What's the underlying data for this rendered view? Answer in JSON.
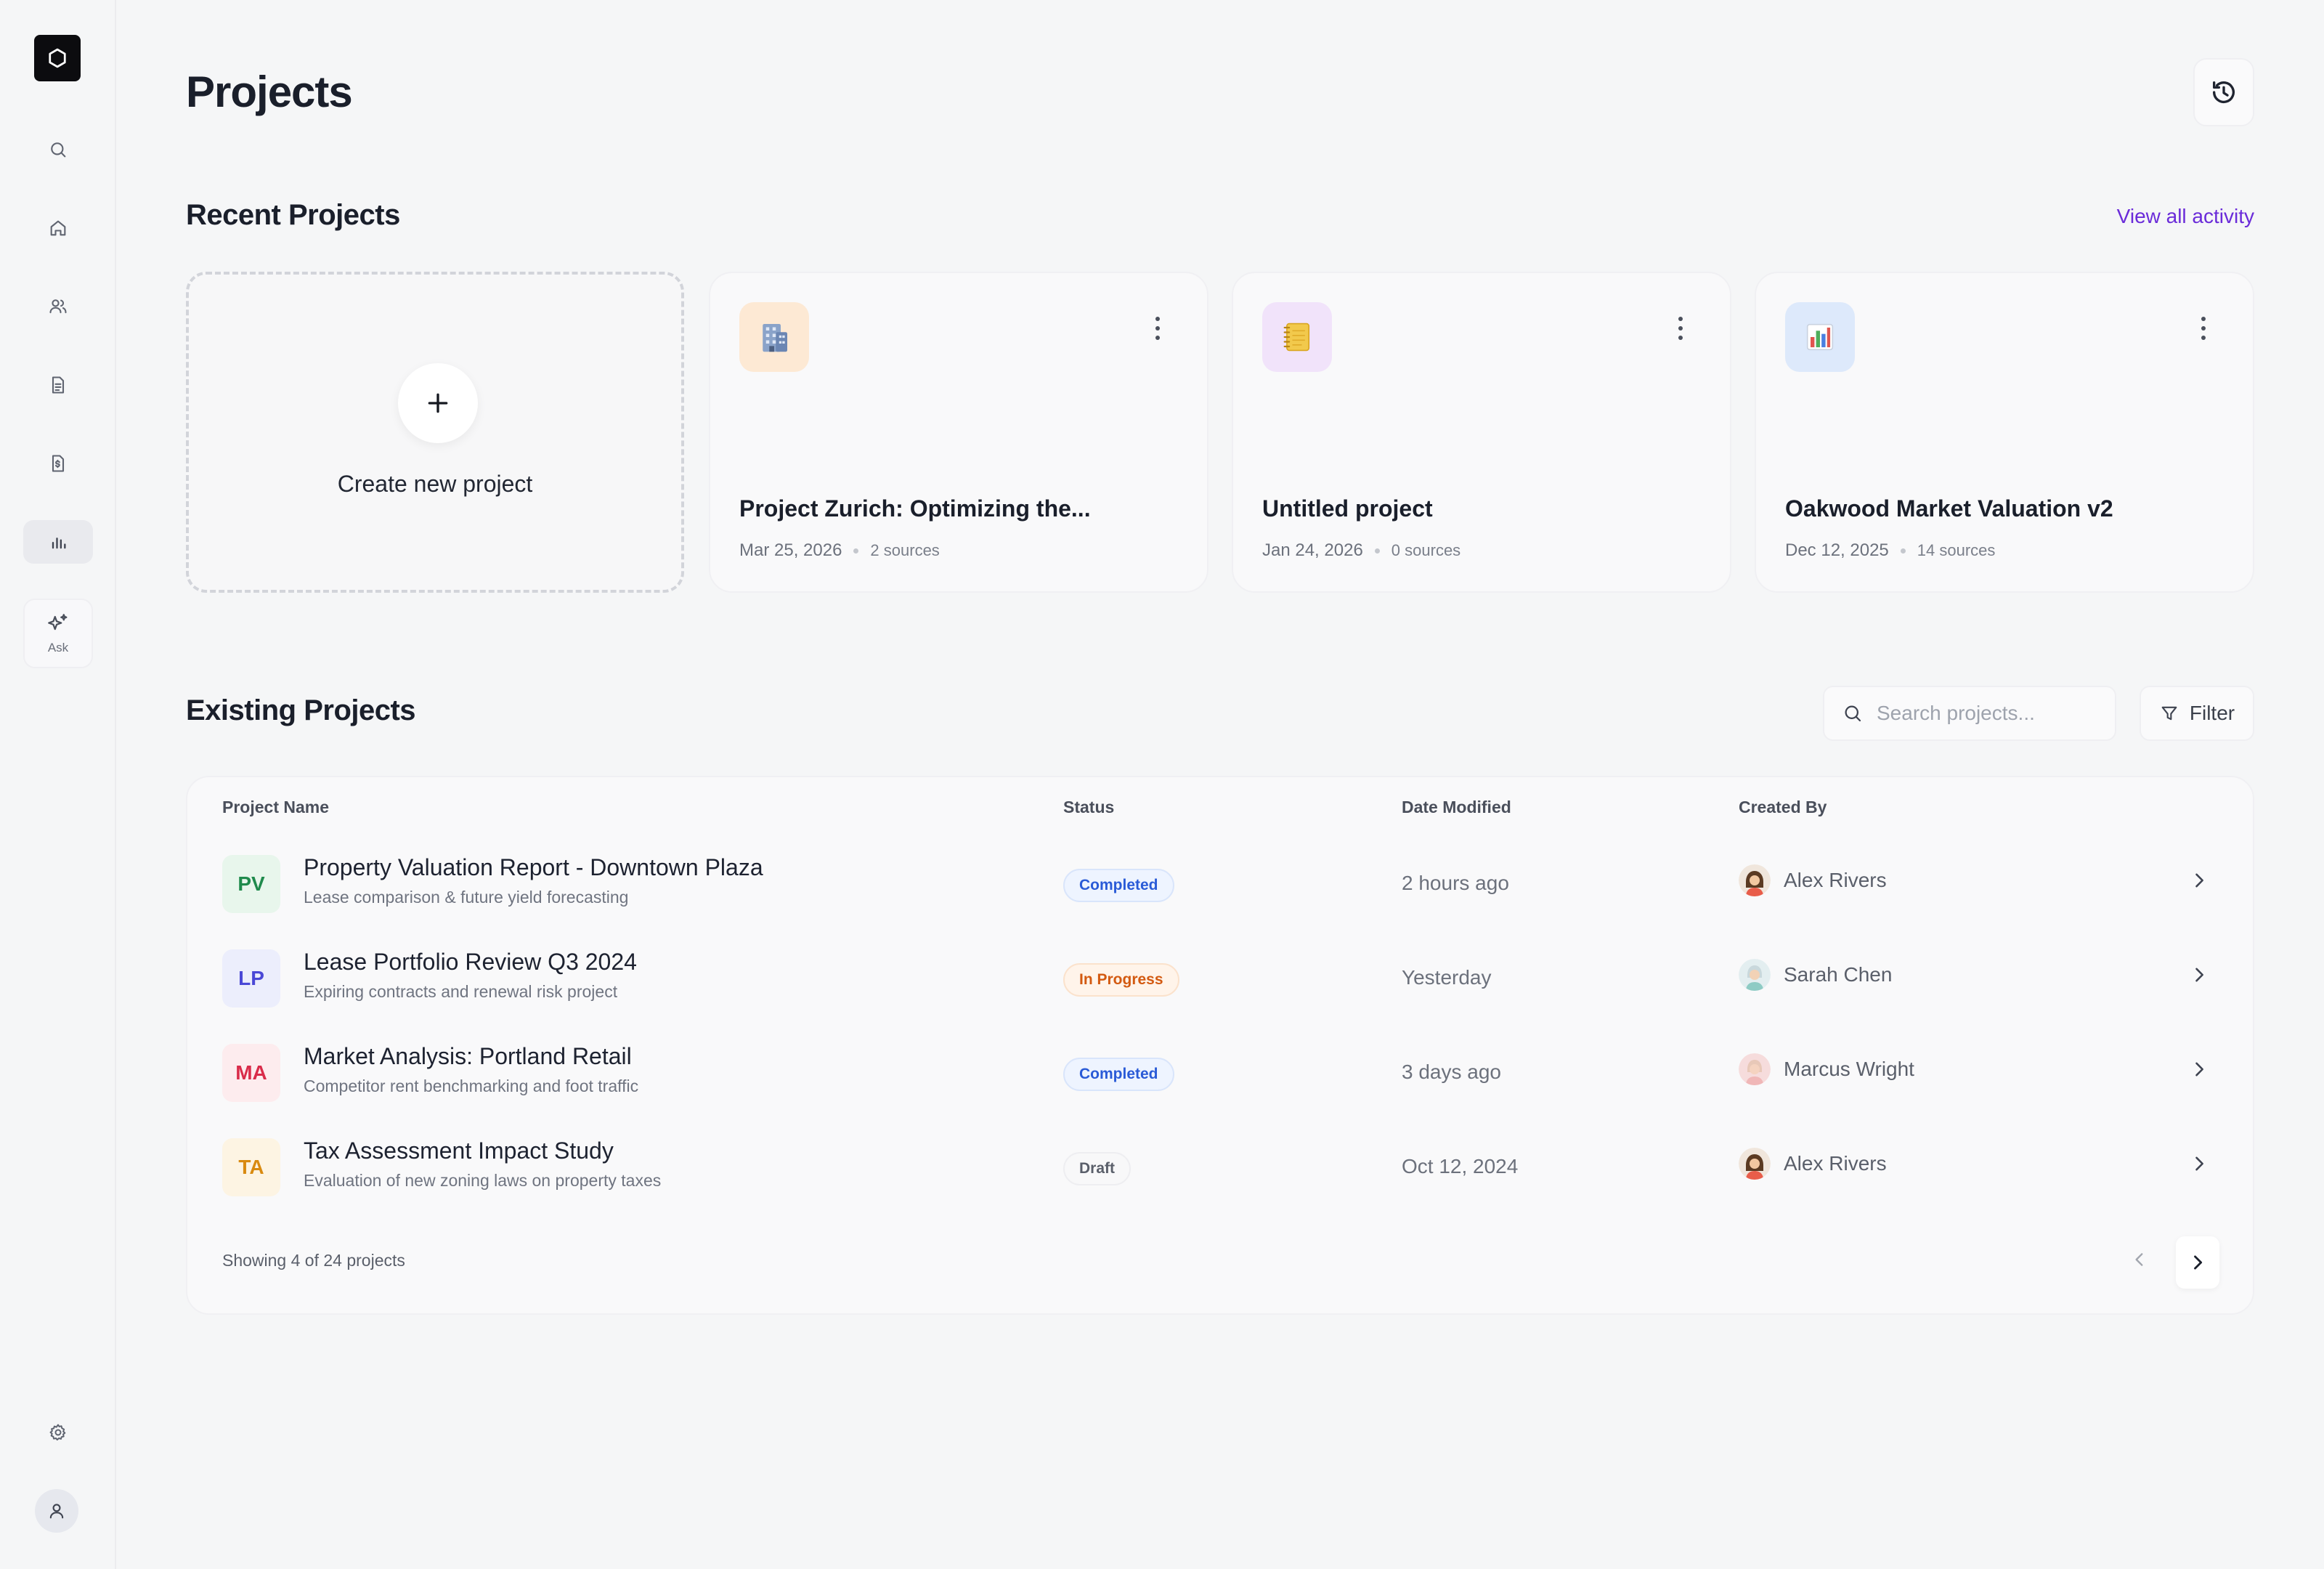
{
  "sidebar": {
    "nav": [
      "search-icon",
      "home-icon",
      "users-icon",
      "document-icon",
      "file-dollar-icon",
      "bar-chart-icon"
    ],
    "active": "bar-chart-icon",
    "ask_label": "Ask"
  },
  "header": {
    "title": "Projects"
  },
  "recent": {
    "title": "Recent Projects",
    "view_all": "View all activity",
    "create_label": "Create new project",
    "cards": [
      {
        "title": "Project Zurich: Optimizing the...",
        "date": "Mar 25, 2026",
        "sources": "2 sources",
        "icon": "building-icon",
        "icon_bg": "#fde9d4"
      },
      {
        "title": "Untitled project",
        "date": "Jan 24, 2026",
        "sources": "0 sources",
        "icon": "notebook-icon",
        "icon_bg": "#f1e3fa"
      },
      {
        "title": "Oakwood Market Valuation v2",
        "date": "Dec 12, 2025",
        "sources": "14 sources",
        "icon": "bar-chart-icon",
        "icon_bg": "#dde9fb"
      }
    ]
  },
  "existing": {
    "title": "Existing Projects",
    "search_placeholder": "Search projects...",
    "filter_label": "Filter",
    "columns": [
      "Project Name",
      "Status",
      "Date Modified",
      "Created By"
    ],
    "rows": [
      {
        "initials": "PV",
        "name": "Property Valuation Report - Downtown Plaza",
        "desc": "Lease comparison & future yield forecasting",
        "status": "Completed",
        "date": "2 hours ago",
        "creator": "Alex Rivers"
      },
      {
        "initials": "LP",
        "name": "Lease Portfolio Review Q3 2024",
        "desc": "Expiring contracts and renewal risk project",
        "status": "In Progress",
        "date": "Yesterday",
        "creator": "Sarah Chen"
      },
      {
        "initials": "MA",
        "name": "Market Analysis: Portland Retail",
        "desc": "Competitor rent benchmarking and foot traffic",
        "status": "Completed",
        "date": "3 days ago",
        "creator": "Marcus Wright"
      },
      {
        "initials": "TA",
        "name": "Tax Assessment Impact Study",
        "desc": "Evaluation of new zoning laws on property taxes",
        "status": "Draft",
        "date": "Oct 12, 2024",
        "creator": "Alex Rivers"
      }
    ],
    "footer": "Showing 4 of 24 projects"
  },
  "colors": {
    "accent": "#6a2bd9",
    "pv": "#1f8a4c",
    "lp": "#4a48d6",
    "ma": "#d92c4a",
    "ta": "#d98a10"
  }
}
